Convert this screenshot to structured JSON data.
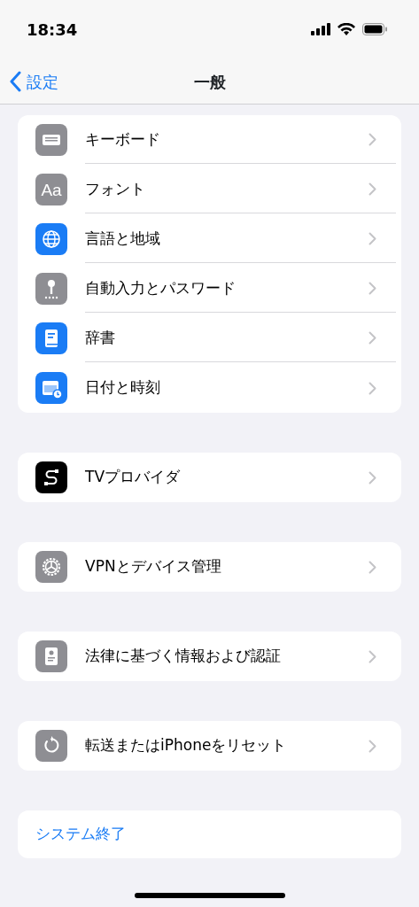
{
  "status_bar": {
    "time": "18:34"
  },
  "nav": {
    "back": "設定",
    "title": "一般"
  },
  "groups": [
    {
      "rows": [
        {
          "label": "キーボード"
        },
        {
          "label": "フォント",
          "icon_label": "Aa"
        },
        {
          "label": "言語と地域"
        },
        {
          "label": "自動入力とパスワード"
        },
        {
          "label": "辞書"
        },
        {
          "label": "日付と時刻"
        }
      ]
    },
    {
      "rows": [
        {
          "label": "TVプロバイダ"
        }
      ]
    },
    {
      "rows": [
        {
          "label": "VPNとデバイス管理"
        }
      ]
    },
    {
      "rows": [
        {
          "label": "法律に基づく情報および認証"
        }
      ]
    },
    {
      "rows": [
        {
          "label": "転送またはiPhoneをリセット"
        }
      ]
    }
  ],
  "action": {
    "label": "システム終了"
  }
}
